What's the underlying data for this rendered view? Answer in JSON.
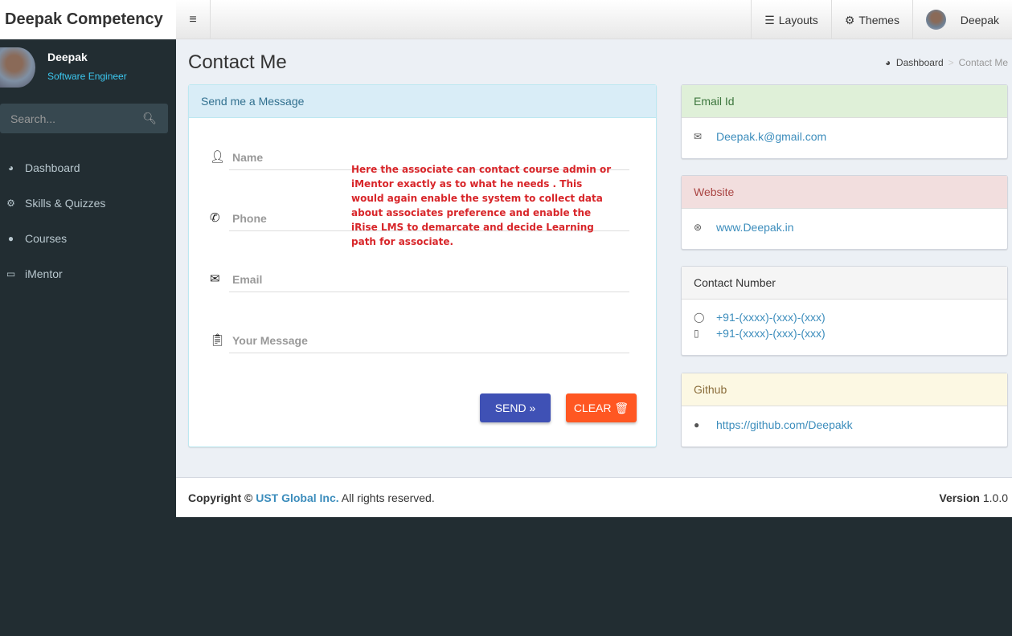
{
  "app": {
    "title": "Deepak Competency"
  },
  "topnav": {
    "layouts": "Layouts",
    "themes": "Themes",
    "user": "Deepak"
  },
  "sidebar": {
    "user_name": "Deepak",
    "user_role": "Software Engineer",
    "search_placeholder": "Search...",
    "items": [
      {
        "label": "Dashboard",
        "icon": "dashboard-icon"
      },
      {
        "label": "Skills & Quizzes",
        "icon": "gears-icon"
      },
      {
        "label": "Courses",
        "icon": "globe-icon"
      },
      {
        "label": "iMentor",
        "icon": "laptop-icon"
      }
    ]
  },
  "page": {
    "title": "Contact Me",
    "breadcrumb": [
      "Dashboard",
      "Contact Me"
    ]
  },
  "form": {
    "header": "Send me a Message",
    "name": "Name",
    "phone": "Phone",
    "email": "Email",
    "message": "Your Message",
    "send": "SEND »",
    "clear": "CLEAR",
    "annotation": "Here the associate can contact course admin or iMentor exactly as to what he needs . This would again enable the system to collect data about associates preference and enable the iRise LMS to demarcate and decide Learning path for associate."
  },
  "cards": {
    "email": {
      "title": "Email Id",
      "value": "Deepak.k@gmail.com"
    },
    "website": {
      "title": "Website",
      "value": "www.Deepak.in"
    },
    "contact": {
      "title": "Contact Number",
      "whatsapp": "+91-(xxxx)-(xxx)-(xxx)",
      "mobile": "+91-(xxxx)-(xxx)-(xxx)"
    },
    "github": {
      "title": "Github",
      "value": "https://github.com/Deepakk"
    }
  },
  "footer": {
    "copyright": "Copyright ©",
    "company": "UST Global Inc.",
    "rights": "All rights reserved.",
    "version_label": "Version",
    "version": "1.0.0"
  },
  "colors": {
    "send": "#3f51b5",
    "clear": "#ff5722",
    "sidebar": "#222d32"
  }
}
